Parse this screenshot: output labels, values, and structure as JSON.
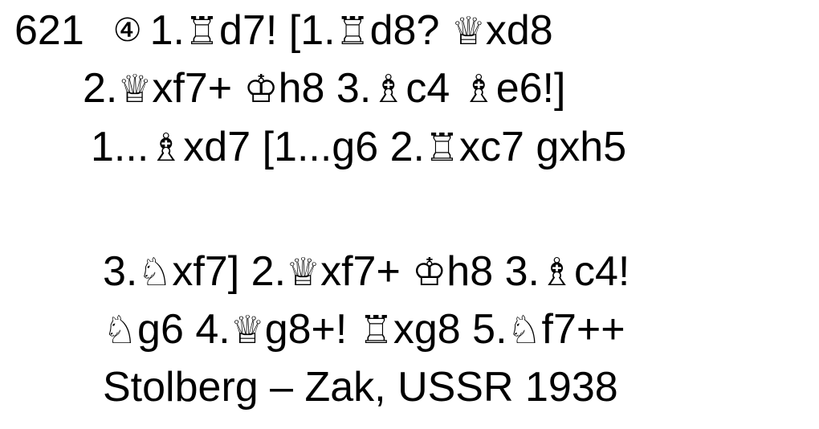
{
  "problem": {
    "number": "621",
    "difficulty_mark": "④",
    "lines": [
      [
        "1.",
        "♖",
        "d7! [1.",
        "♖",
        "d8? ",
        "♕",
        "xd8"
      ],
      [
        "2.",
        "♕",
        "xf7+ ",
        "♔",
        "h8 3.",
        "♗",
        "c4 ",
        "♗",
        "e6!]"
      ],
      [
        "1...",
        "♗",
        "xd7 [1...g6 2.",
        "♖",
        "xc7 gxh5"
      ],
      [
        "3.",
        "♘",
        "xf7] 2.",
        "♕",
        "xf7+ ",
        "♔",
        "h8 3.",
        "♗",
        "c4!"
      ],
      [
        "♘",
        "g6 4.",
        "♕",
        "g8+! ",
        "♖",
        "xg8 5.",
        "♘",
        "f7++"
      ]
    ],
    "source": "Stolberg – Zak, USSR 1938"
  }
}
